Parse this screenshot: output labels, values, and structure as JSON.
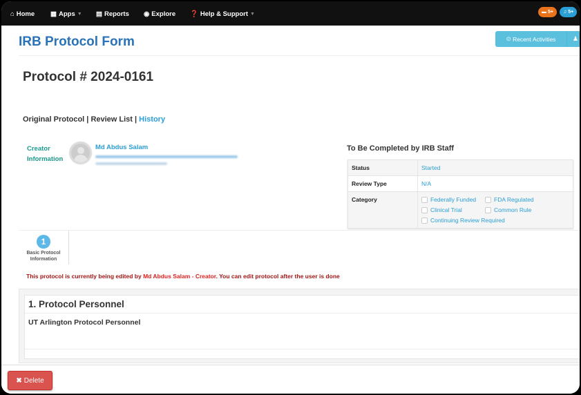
{
  "nav": {
    "items": [
      {
        "icon": "home-icon",
        "label": "Home"
      },
      {
        "icon": "grid-icon",
        "label": "Apps",
        "caret": true
      },
      {
        "icon": "table-icon",
        "label": "Reports"
      },
      {
        "icon": "globe-icon",
        "label": "Explore"
      },
      {
        "icon": "question-icon",
        "label": "Help & Support",
        "caret": true
      }
    ],
    "badges": {
      "messages": "5+",
      "notifications": "5+"
    },
    "badge_colors": {
      "messages": "#e8731a",
      "notifications": "#2a9fd6"
    }
  },
  "header": {
    "title": "IRB Protocol Form",
    "recent_activities": "Recent Activities"
  },
  "protocol": {
    "number": "Protocol # 2024-0161",
    "links": [
      "Original Protocol",
      "Review List",
      "History"
    ],
    "separator": " | "
  },
  "creator": {
    "label_line1": "Creator",
    "label_line2": "Information",
    "name": "Md Abdus Salam"
  },
  "staff": {
    "heading": "To Be Completed by IRB Staff",
    "rows": {
      "status": {
        "label": "Status",
        "value": "Started"
      },
      "review_type": {
        "label": "Review Type",
        "value": "N/A"
      },
      "category": {
        "label": "Category"
      }
    },
    "categories": [
      "Federally Funded",
      "FDA Regulated",
      "Clinical Trial",
      "Common Rule",
      "Continuing Review Required"
    ]
  },
  "tabs": [
    {
      "number": "1",
      "label_line1": "Basic Protocol",
      "label_line2": "Information"
    }
  ],
  "message": {
    "prefix": "This protocol is currently being edited by ",
    "editor": "Md Abdus Salam - Creator",
    "suffix": ". You can edit protocol after the user is done"
  },
  "section": {
    "title": "1. Protocol Personnel",
    "subtitle": "UT Arlington Protocol Personnel"
  },
  "footer": {
    "delete": "Delete"
  }
}
